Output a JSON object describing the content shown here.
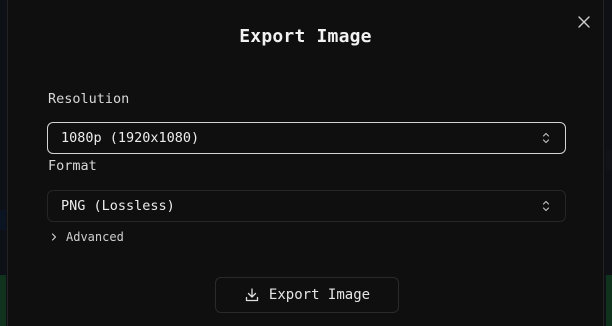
{
  "dialog": {
    "title": "Export Image",
    "close_icon": "close-icon"
  },
  "resolution": {
    "label": "Resolution",
    "selected": "1080p (1920x1080)",
    "icon": "chevron-up-down-icon"
  },
  "format": {
    "label": "Format",
    "selected": "PNG (Lossless)",
    "icon": "chevron-up-down-icon"
  },
  "advanced": {
    "label": "Advanced",
    "icon": "chevron-right-icon"
  },
  "export_button": {
    "label": "Export Image",
    "icon": "download-icon"
  },
  "colors": {
    "dialog_bg": "#0f0f0f",
    "text": "#ececec",
    "focus_border": "#d4d4d4",
    "border": "#262626"
  }
}
